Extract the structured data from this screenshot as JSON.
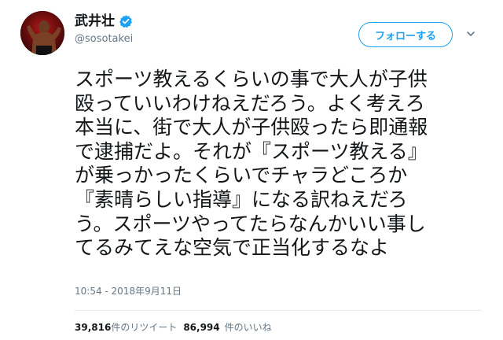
{
  "user": {
    "display_name": "武井壮",
    "handle": "@sosotakei",
    "verified_icon": "verified-badge-icon"
  },
  "actions": {
    "follow_label": "フォローする",
    "menu_icon": "chevron-down-icon"
  },
  "tweet": {
    "lines": [
      "スポーツ教えるくらいの事で大人が子供",
      "殴っていいわけねえだろう。よく考えろ",
      "本当に、街で大人が子供殴ったら即通報",
      "で逮捕だよ。それが『スポーツ教える』",
      "が乗っかったくらいでチャラどころか",
      "『素晴らしい指導』になる訳ねえだろ",
      "う。スポーツやってたらなんかいい事し",
      "てるみてえな空気で正当化するなよ"
    ],
    "timestamp": "10:54 - 2018年9月11日"
  },
  "stats": {
    "retweets_count": "39,816",
    "retweets_label": "件のリツイート",
    "likes_count": "86,994",
    "likes_label": "件のいいね"
  },
  "colors": {
    "accent": "#1da1f2",
    "secondary_text": "#657786",
    "primary_text": "#14171a",
    "divider": "#e6ecf0"
  }
}
